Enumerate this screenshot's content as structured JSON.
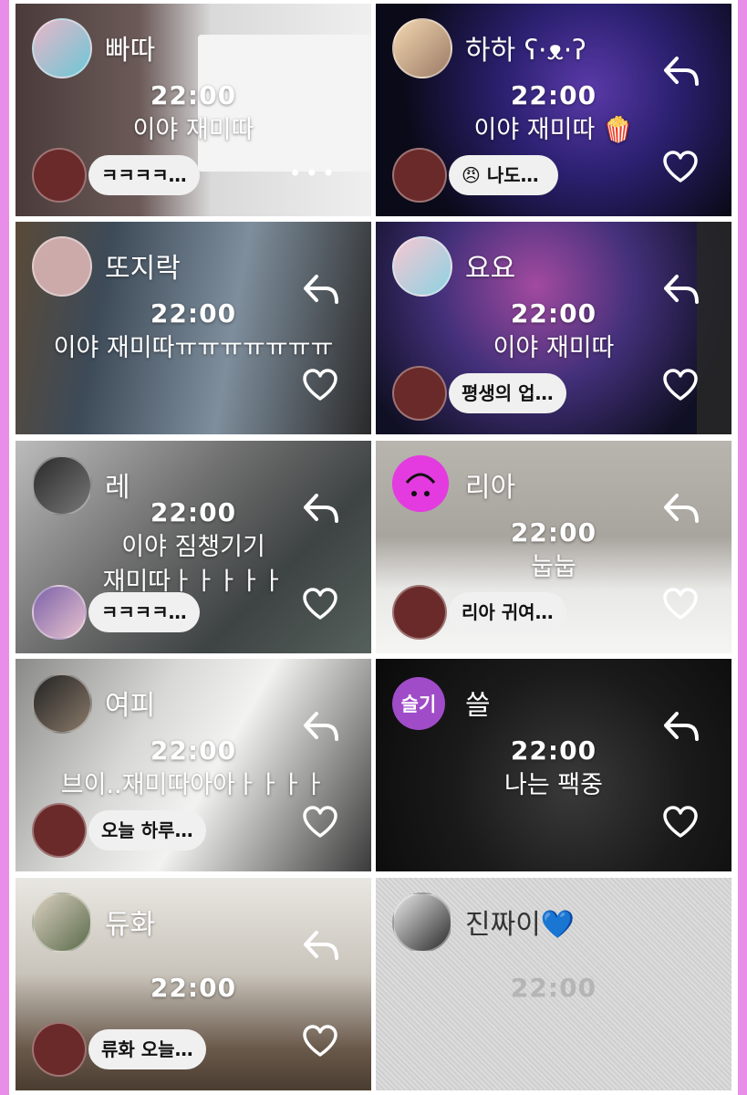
{
  "cards": [
    {
      "name": "빠따",
      "time": "22:00",
      "caption": "이야 재미따",
      "reply": "ㅋㅋㅋㅋ…",
      "more": "•••"
    },
    {
      "name": "하하 ʕ·ᴥ·ʔ",
      "time": "22:00",
      "caption": "이야 재미따 🍿",
      "reply": "😠 나도…"
    },
    {
      "name": "또지락",
      "time": "22:00",
      "caption": "이야 재미따ㅠㅠㅠㅠㅠㅠㅠ",
      "reply": ""
    },
    {
      "name": "요요",
      "time": "22:00",
      "caption": "이야 재미따",
      "reply": "평생의 업…"
    },
    {
      "name": "레",
      "time": "22:00",
      "caption": "이야 짐챙기기\n재미따ㅏㅏㅏㅏㅏ",
      "reply": "ㅋㅋㅋㅋ…"
    },
    {
      "name": "리아",
      "time": "22:00",
      "caption": "눕눕",
      "reply": "리아 귀여…"
    },
    {
      "name": "여피",
      "time": "22:00",
      "caption": "브이..재미따아아ㅏㅏㅏㅏ",
      "reply": "오늘 하루…"
    },
    {
      "name": "쓸",
      "avatar_text": "슬기",
      "time": "22:00",
      "caption": "나는 팩중",
      "reply": ""
    },
    {
      "name": "듀화",
      "time": "22:00",
      "caption": "",
      "reply": "류화 오늘…"
    },
    {
      "name": "진짜이💙",
      "time": "22:00",
      "caption": "",
      "reply": ""
    }
  ],
  "icons": {
    "reply": "reply-arrow-icon",
    "heart": "heart-outline-icon"
  },
  "colors": {
    "border": "#e88ee8",
    "bubble": "#f0f0f0",
    "text": "#ffffff",
    "accent_avatar": "#a04cc8"
  }
}
